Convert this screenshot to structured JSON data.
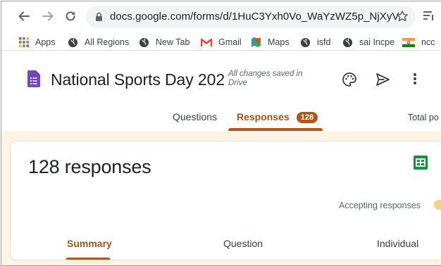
{
  "browser": {
    "url": "docs.google.com/forms/d/1HuC3Yxh0Vo_WaYzWZ5p_NjXyV...",
    "bookmarks": [
      {
        "label": "Apps",
        "icon": "apps-grid-icon"
      },
      {
        "label": "All Regions",
        "icon": "globe-icon"
      },
      {
        "label": "New Tab",
        "icon": "globe-icon"
      },
      {
        "label": "Gmail",
        "icon": "gmail-icon"
      },
      {
        "label": "Maps",
        "icon": "maps-icon"
      },
      {
        "label": "isfd",
        "icon": "globe-icon"
      },
      {
        "label": "sai Incpe",
        "icon": "globe-icon"
      },
      {
        "label": "ncc",
        "icon": "india-flag-icon"
      }
    ]
  },
  "form": {
    "title": "National Sports Day 202",
    "save_status": "All changes saved in Drive",
    "tabs": [
      {
        "label": "Questions"
      },
      {
        "label": "Responses",
        "badge": "128"
      },
      {
        "label": "Total po"
      }
    ]
  },
  "responses": {
    "count_label": "128 responses",
    "accepting_label": "Accepting responses",
    "subtabs": [
      {
        "label": "Summary"
      },
      {
        "label": "Question"
      },
      {
        "label": "Individual"
      }
    ]
  },
  "colors": {
    "accent": "#b0581c",
    "accent_text": "#a1531e",
    "content_bg": "#fbf3e4",
    "forms_purple": "#7248b9",
    "sheets_green": "#1e8e3e"
  }
}
